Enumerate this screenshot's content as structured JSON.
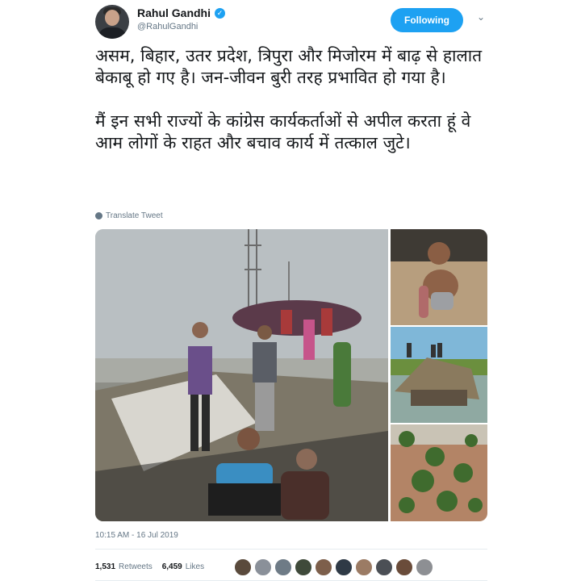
{
  "header": {
    "display_name": "Rahul Gandhi",
    "handle": "@RahulGandhi",
    "follow_label": "Following",
    "verified_mark": "✓",
    "caret": "⌄"
  },
  "tweet": {
    "line1": "असम, बिहार, उतर प्रदेश, त्रिपुरा और मिजोरम में बाढ़ से हालात बेकाबू हो गए है। जन-जीवन बुरी तरह प्रभावित हो गया है।",
    "line2": "मैं इन सभी राज्यों के कांग्रेस कार्यकर्ताओं से अपील करता हूं वे आम लोगों के राहत और बचाव कार्य में तत्काल जुटे।",
    "translate_label": "Translate Tweet"
  },
  "media": {
    "photos": [
      "flood-crowd-embankment",
      "child-in-floodwater",
      "submerged-thatched-hut",
      "flooded-trees-aerial"
    ]
  },
  "footer": {
    "timestamp": "10:15 AM - 16 Jul 2019",
    "retweets_count": "1,531",
    "retweets_label": "Retweets",
    "likes_count": "6,459",
    "likes_label": "Likes"
  },
  "colors": {
    "accent": "#1da1f2",
    "muted_text": "#657786",
    "liker_avatars": [
      "#5a4a3c",
      "#8a9099",
      "#6e7b86",
      "#3f4a3a",
      "#7d5f4b",
      "#2f3a46",
      "#9b7b64",
      "#4b4f55",
      "#6a4c3a",
      "#8d8f93"
    ]
  }
}
